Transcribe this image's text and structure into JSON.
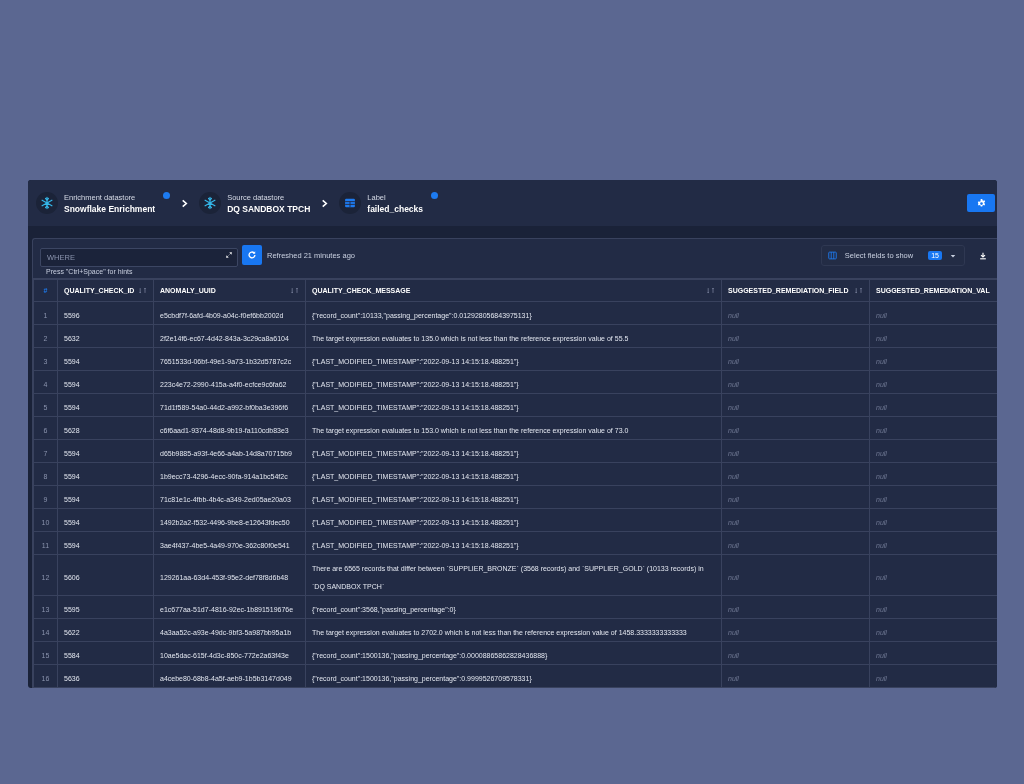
{
  "breadcrumbs": [
    {
      "kind": "snowflake",
      "label": "Enrichment datastore",
      "value": "Snowflake Enrichment",
      "info": true
    },
    {
      "kind": "snowflake",
      "label": "Source datastore",
      "value": "DQ SANDBOX TPCH",
      "info": false
    },
    {
      "kind": "table",
      "label": "Label",
      "value": "failed_checks",
      "info": true
    }
  ],
  "filter": {
    "placeholder": "WHERE",
    "hint": "Press \"Ctrl+Space\" for hints"
  },
  "refreshed": "Refreshed 21 minutes ago",
  "field_selector": {
    "label": "Select fields to show",
    "count": "15"
  },
  "table": {
    "columns": [
      {
        "label": "#",
        "sortable": false
      },
      {
        "label": "QUALITY_CHECK_ID",
        "sortable": true
      },
      {
        "label": "ANOMALY_UUID",
        "sortable": true
      },
      {
        "label": "QUALITY_CHECK_MESSAGE",
        "sortable": true
      },
      {
        "label": "SUGGESTED_REMEDIATION_FIELD",
        "sortable": true
      },
      {
        "label": "SUGGESTED_REMEDIATION_VAL",
        "sortable": false
      }
    ],
    "rows": [
      [
        "1",
        "5596",
        "e5cbdf7f-6afd-4b09-a04c-f0ef6bb2002d",
        "{\"record_count\":10133,\"passing_percentage\":0.012928056843975131}",
        "null",
        "null"
      ],
      [
        "2",
        "5632",
        "2f2e14f6-ec67-4d42-843a-3c29ca8a6104",
        "The target expression evaluates to 135.0 which is not less than the reference expression value of 55.5",
        "null",
        "null"
      ],
      [
        "3",
        "5594",
        "7651533d-06bf-49e1-9a73-1b32d5787c2c",
        "{\"LAST_MODIFIED_TIMESTAMP\":\"2022-09-13 14:15:18.488251\"}",
        "null",
        "null"
      ],
      [
        "4",
        "5594",
        "223c4e72-2990-415a-a4f0-ecfce9c6fa62",
        "{\"LAST_MODIFIED_TIMESTAMP\":\"2022-09-13 14:15:18.488251\"}",
        "null",
        "null"
      ],
      [
        "5",
        "5594",
        "71d1f589-54a0-44d2-a992-bf0ba3e396f6",
        "{\"LAST_MODIFIED_TIMESTAMP\":\"2022-09-13 14:15:18.488251\"}",
        "null",
        "null"
      ],
      [
        "6",
        "5628",
        "c6f6aad1-9374-48d8-9b19-fa110cdb83e3",
        "The target expression evaluates to 153.0 which is not less than the reference expression value of 73.0",
        "null",
        "null"
      ],
      [
        "7",
        "5594",
        "d65b9885-a93f-4e66-a4ab-14d8a70715b9",
        "{\"LAST_MODIFIED_TIMESTAMP\":\"2022-09-13 14:15:18.488251\"}",
        "null",
        "null"
      ],
      [
        "8",
        "5594",
        "1b9ecc73-4296-4ecc-90fa-914a1bc54f2c",
        "{\"LAST_MODIFIED_TIMESTAMP\":\"2022-09-13 14:15:18.488251\"}",
        "null",
        "null"
      ],
      [
        "9",
        "5594",
        "71c81e1c-4fbb-4b4c-a349-2ed05ae20a03",
        "{\"LAST_MODIFIED_TIMESTAMP\":\"2022-09-13 14:15:18.488251\"}",
        "null",
        "null"
      ],
      [
        "10",
        "5594",
        "1492b2a2-f532-4496-9be8-e12643fdec50",
        "{\"LAST_MODIFIED_TIMESTAMP\":\"2022-09-13 14:15:18.488251\"}",
        "null",
        "null"
      ],
      [
        "11",
        "5594",
        "3ae4f437-4be5-4a49-970e-362c80f0e541",
        "{\"LAST_MODIFIED_TIMESTAMP\":\"2022-09-13 14:15:18.488251\"}",
        "null",
        "null"
      ],
      [
        "12",
        "5606",
        "129261aa-63d4-453f-95e2-def78f8d6b48",
        "There are 6565 records that differ between `SUPPLIER_BRONZE` (3568 records) and `SUPPLIER_GOLD` (10133 records) in `DQ SANDBOX TPCH`",
        "null",
        "null"
      ],
      [
        "13",
        "5595",
        "e1c677aa-51d7-4816-92ec-1b891519676e",
        "{\"record_count\":3568,\"passing_percentage\":0}",
        "null",
        "null"
      ],
      [
        "14",
        "5622",
        "4a3aa52c-a93e-49dc-9bf3-5a987bb95a1b",
        "The target expression evaluates to 2702.0 which is not less than the reference expression value of 1458.3333333333333",
        "null",
        "null"
      ],
      [
        "15",
        "5584",
        "10ae5dac-615f-4d3c-850c-772e2a63f43e",
        "{\"record_count\":1500136,\"passing_percentage\":0.00008865862828436888}",
        "null",
        "null"
      ],
      [
        "16",
        "5636",
        "a4cebe80-68b8-4a5f-aeb9-1b5b3147d049",
        "{\"record_count\":1500136,\"passing_percentage\":0.9999526709578331}",
        "null",
        "null"
      ]
    ]
  }
}
